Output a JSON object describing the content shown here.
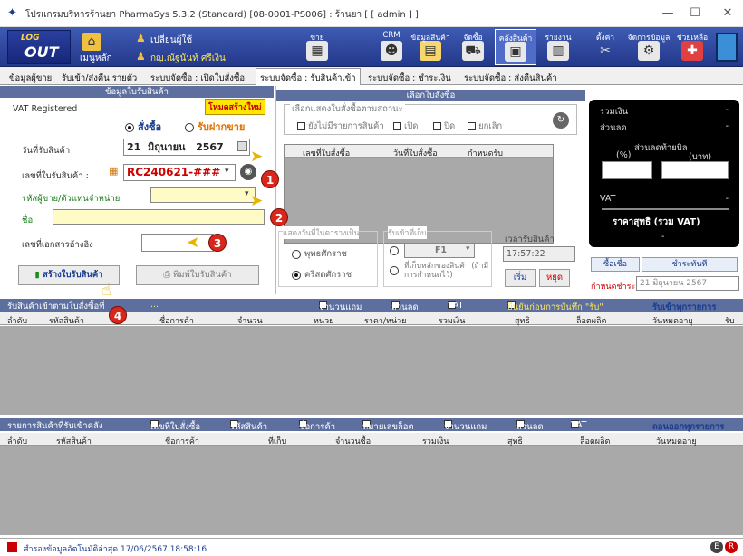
{
  "window": {
    "title": "โปรแกรมบริหารร้านยา PharmaSys 5.3.2 (Standard) [08-0001-PS006] : ร้านยา [ [ admin ] ]",
    "min": "—",
    "max": "☐",
    "close": "✕"
  },
  "toolbar": {
    "logout_top": "LOG",
    "logout_main": "OUT",
    "menu_label": "เมนูหลัก",
    "change_user": "เปลี่ยนผู้ใช้",
    "username": "กญ.ณัฐนันท์ ศรีเงิน",
    "buttons": [
      "ขาย",
      "CRM",
      "ข้อมูลสินค้า",
      "จัดซื้อ",
      "คลังสินค้า",
      "รายงาน",
      "ตั้งค่า",
      "จัดการข้อมูล",
      "ช่วยเหลือ"
    ]
  },
  "tabs": [
    "ข้อมูลผู้ขาย",
    "รับเข้า/ส่งคืน รายตัว",
    "ระบบจัดซื้อ : เปิดใบสั่งซื้อ",
    "ระบบจัดซื้อ : รับสินค้าเข้า",
    "ระบบจัดซื้อ : ชำระเงิน",
    "ระบบจัดซื้อ : ส่งคืนสินค้า"
  ],
  "left": {
    "header": "ข้อมูลใบรับสินค้า",
    "vat": "VAT Registered",
    "mode_badge": "โหมดสร้างใหม่",
    "radio_buy": "สั่งซื้อ",
    "radio_consign": "รับฝากขาย",
    "receive_date_label": "วันที่รับสินค้า",
    "receive_date_day": "21",
    "receive_date_month": "มิถุนายน",
    "receive_date_year": "2567",
    "doc_no_label": "เลขที่ใบรับสินค้า :",
    "doc_no": "RC240621-###",
    "vendor_label": "รหัสผู้ขาย/ตัวแทนจำหน่าย",
    "name_label": "ชื่อ",
    "ref_label": "เลขที่เอกสารอ้างอิง",
    "create_btn": "สร้างใบรับสินค้า",
    "print_btn": "พิมพ์ใบรับสินค้า"
  },
  "mid": {
    "header": "เลือกใบสั่งซื้อ",
    "filter_legend": "เลือกแสดงใบสั่งซื้อตามสถานะ",
    "filter_pending": "ยังไม่มีรายการสินค้า",
    "filter_open": "เปิด",
    "filter_closed": "ปิด",
    "filter_cancel": "ยกเลิก",
    "cols": [
      "เลขที่ใบสั่งซื้อ",
      "วันที่ใบสั่งซื้อ",
      "กำหนดรับ"
    ],
    "date_legend": "แสดงวันที่ในตารางเป็น",
    "date_buddhist": "พุทธศักราช",
    "date_christian": "คริสตศักราช",
    "store_legend": "รับเข้าที่เก็บ",
    "store_value": "F1",
    "store_default": "ที่เก็บหลักของสินค้า (ถ้ามีการกำหนดไว้)",
    "time_label": "เวลารับสินค้า",
    "time_value": "17:57:22",
    "start_btn": "เริ่ม",
    "stop_btn": "หยุด"
  },
  "right": {
    "total": "รวมเงิน",
    "discount": "ส่วนลด",
    "bill_discount": "ส่วนลดท้ายบิล",
    "pct": "(%)",
    "baht": "(บาท)",
    "vat": "VAT",
    "net": "ราคาสุทธิ (รวม VAT)",
    "dash": "-",
    "credit_btn": "ซื้อเชื่อ",
    "cash_btn": "ชำระทันที",
    "due_label": "กำหนดชำระ",
    "due_day": "21",
    "due_month": "มิถุนายน",
    "due_year": "2567"
  },
  "incoming": {
    "title": "รับสินค้าเข้าตามใบสั่งซื้อที่",
    "title_value": "...",
    "opt_free": "จำนวนแถม",
    "opt_discount": "ส่วนลด",
    "opt_vat": "VAT",
    "opt_confirm": "ยืนยันก่อนการบันทึก \"รับ\"",
    "receive_all": "รับเข้าทุกรายการ",
    "cols": [
      "ลำดับ",
      "รหัสสินค้า",
      "ชื่อการค้า",
      "จำนวน",
      "หน่วย",
      "ราคา/หน่วย",
      "รวมเงิน",
      "สุทธิ",
      "ล็อตผลิต",
      "วันหมดอายุ",
      "รับ"
    ]
  },
  "warehouse": {
    "title": "รายการสินค้าที่รับเข้าคลัง",
    "opt_po": "เลขที่ใบสั่งซื้อ",
    "opt_code": "รหัสสินค้า",
    "opt_trade": "ชื่อการค้า",
    "opt_lot": "หมายเลขล็อต",
    "opt_free": "จำนวนแถม",
    "opt_discount": "ส่วนลด",
    "opt_vat": "VAT",
    "remove_all": "ถอนออกทุกรายการ",
    "cols": [
      "ลำดับ",
      "รหัสสินค้า",
      "ชื่อการค้า",
      "ที่เก็บ",
      "จำนวนซื้อ",
      "รวมเงิน",
      "สุทธิ",
      "ล็อตผลิต",
      "วันหมดอายุ"
    ]
  },
  "callouts": [
    "1",
    "2",
    "3",
    "4"
  ],
  "status": {
    "text": "สำรองข้อมูลอัตโนมัติล่าสุด 17/06/2567 18:58:16"
  }
}
